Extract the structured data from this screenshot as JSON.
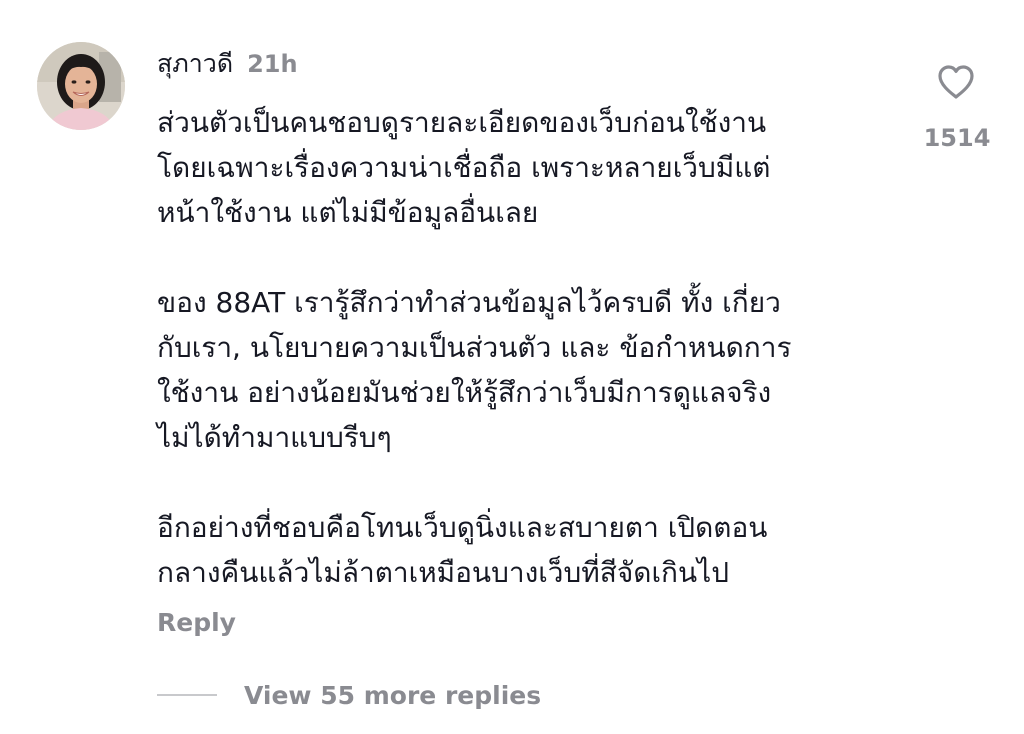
{
  "comment": {
    "username": "สุภาวดี",
    "timestamp": "21h",
    "paragraphs": [
      [
        "ส่วนตัวเป็นคนชอบดูรายละเอียดของเว็บก่อนใช้งาน",
        "โดยเฉพาะเรื่องความน่าเชื่อถือ เพราะหลายเว็บมีแต่",
        "หน้าใช้งาน แต่ไม่มีข้อมูลอื่นเลย"
      ],
      [
        "ของ 88AT เรารู้สึกว่าทำส่วนข้อมูลไว้ครบดี ทั้ง เกี่ยว",
        "กับเรา, นโยบายความเป็นส่วนตัว และ ข้อกำหนดการ",
        "ใช้งาน อย่างน้อยมันช่วยให้รู้สึกว่าเว็บมีการดูแลจริง",
        "ไม่ได้ทำมาแบบรีบๆ"
      ],
      [
        "อีกอย่างที่ชอบคือโทนเว็บดูนิ่งและสบายตา เปิดตอน",
        "กลางคืนแล้วไม่ล้าตาเหมือนบางเว็บที่สีจัดเกินไป"
      ]
    ],
    "like_icon": "heart-outline-icon",
    "like_count": "1514",
    "reply_label": "Reply",
    "view_replies_label": "View 55 more replies"
  },
  "colors": {
    "text_primary": "#161823",
    "text_secondary": "#8a8b91",
    "divider": "#c8c9cc",
    "background": "#ffffff"
  }
}
